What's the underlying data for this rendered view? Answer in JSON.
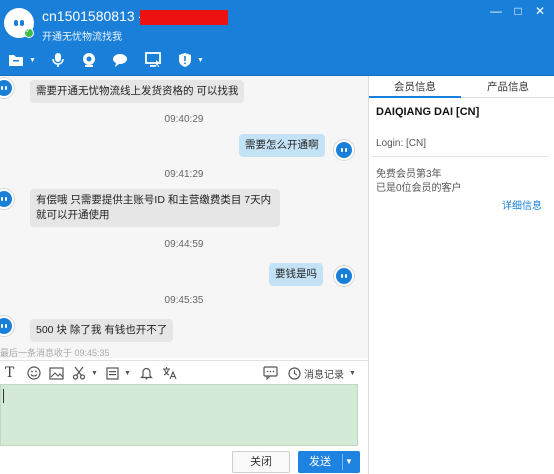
{
  "header": {
    "contact_name": "cn1501580813 -",
    "status_text": "开通无忧物流找我",
    "window_controls": [
      "minimize-icon",
      "maximize-icon",
      "close-icon"
    ]
  },
  "toolbar": {
    "icons": [
      "folder-icon",
      "microphone-icon",
      "webcam-icon",
      "chat-bubbles-icon",
      "screen-share-icon",
      "shield-icon"
    ]
  },
  "chat": {
    "messages": [
      {
        "direction": "in",
        "text": "需要开通无忧物流线上发货资格的 可以找我"
      },
      {
        "time": "09:40:29"
      },
      {
        "direction": "out",
        "text": "需要怎么开通啊"
      },
      {
        "time": "09:41:29"
      },
      {
        "direction": "in",
        "text": "有偿哦  只需要提供主账号ID  和主营缴费类目  7天内就可以开通使用"
      },
      {
        "time": "09:44:59"
      },
      {
        "direction": "out",
        "text": "要钱是吗"
      },
      {
        "time": "09:45:35"
      },
      {
        "direction": "in",
        "text": "500 块   除了我 有钱也开不了"
      }
    ],
    "last_message_notice": "最后一条消息收于 09:45:35"
  },
  "compose_toolbar": {
    "icons": [
      "text-format-icon",
      "emoji-icon",
      "image-icon",
      "scissors-icon",
      "calendar-icon",
      "bell-icon",
      "translate-icon",
      "quick-reply-icon",
      "clock-icon"
    ],
    "history_label": "消息记录"
  },
  "compose": {
    "input_value": "",
    "close_label": "关闭",
    "send_label": "发送"
  },
  "sidebar": {
    "tabs": [
      "会员信息",
      "产品信息"
    ],
    "active_tab": 0,
    "member_name": "DAIQIANG DAI   [CN]",
    "login": "Login: [CN]",
    "membership": "免费会员第3年",
    "customers": "已是0位会员的客户",
    "details_link": "详细信息"
  },
  "colors": {
    "brand": "#1a7fd9",
    "incoming_bubble": "#e6e6e6",
    "outgoing_bubble": "#c4e2f6",
    "input_background": "#d4ead6"
  }
}
